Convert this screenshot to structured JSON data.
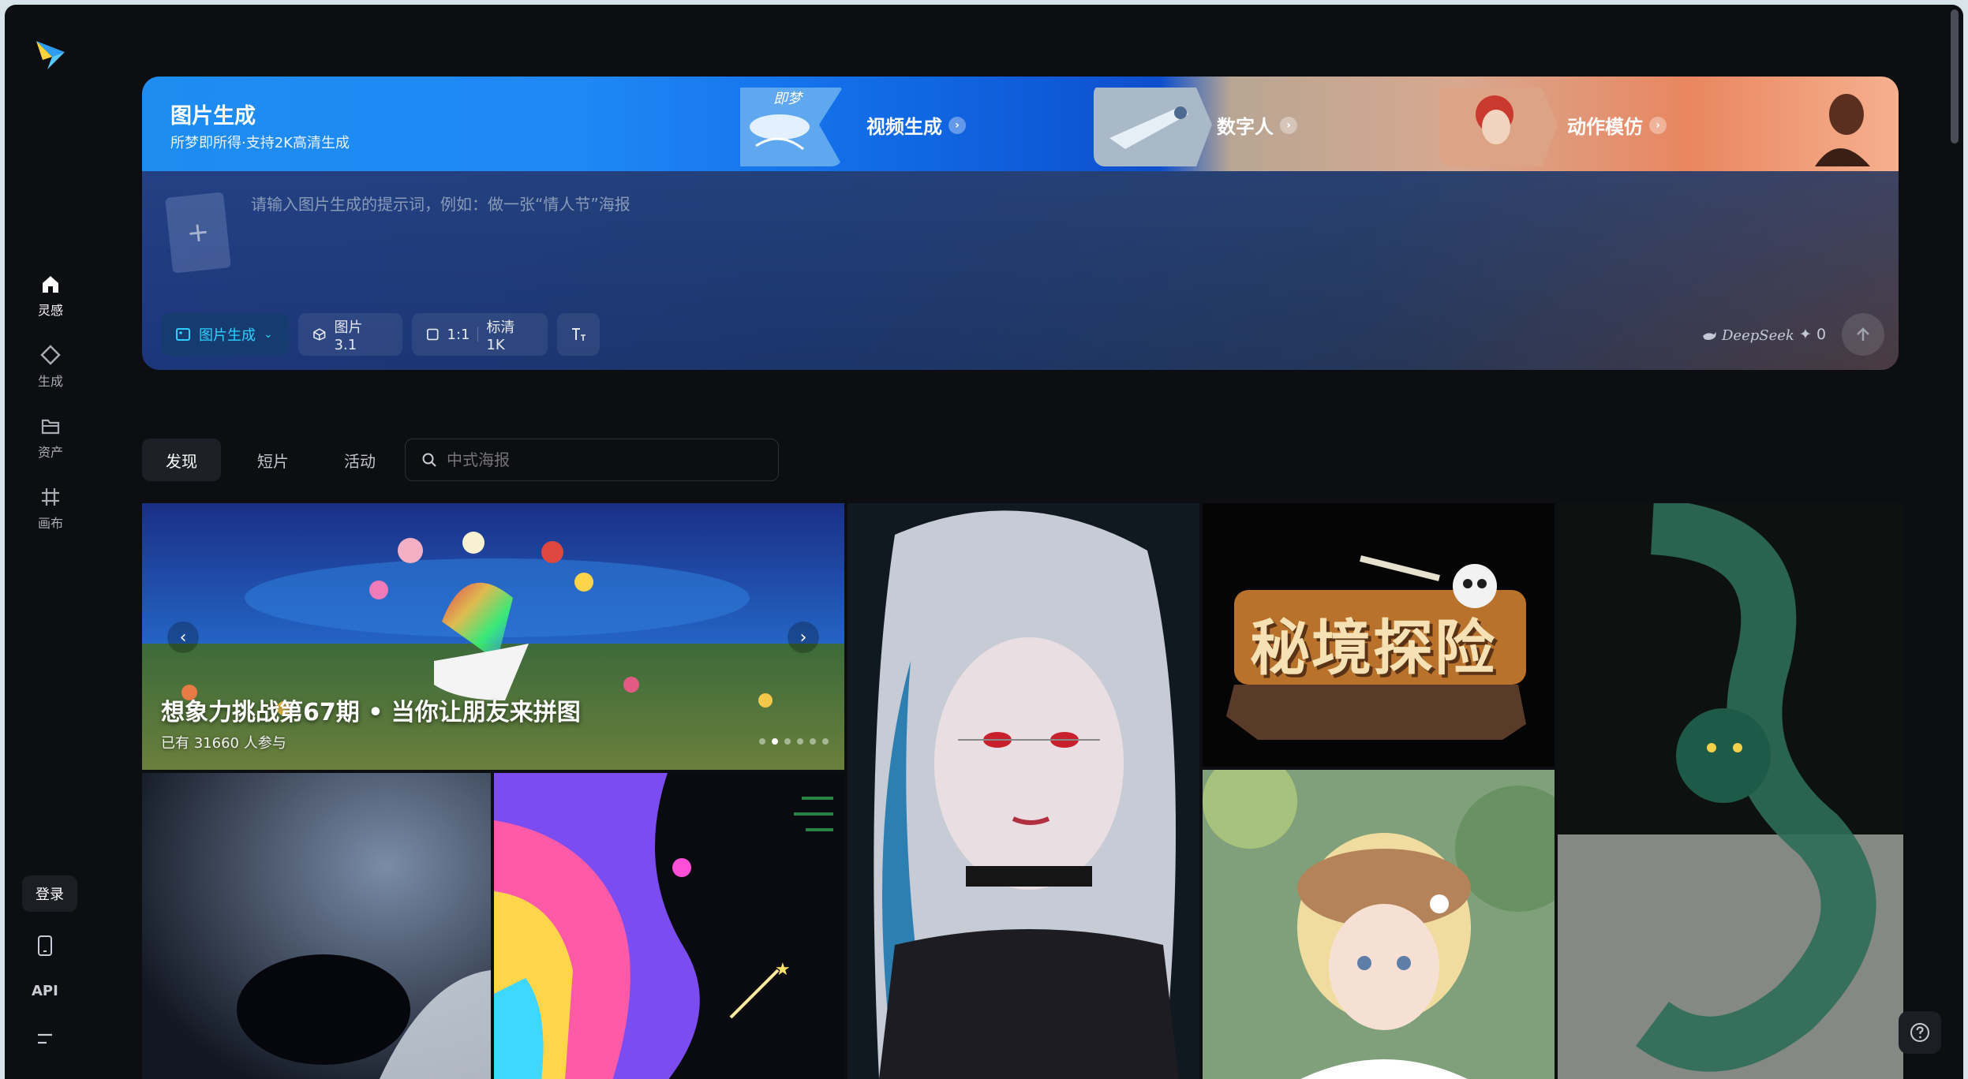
{
  "sidebar": {
    "items": [
      {
        "label": "灵感",
        "icon": "home-icon"
      },
      {
        "label": "生成",
        "icon": "diamond-icon"
      },
      {
        "label": "资产",
        "icon": "folder-icon"
      },
      {
        "label": "画布",
        "icon": "canvas-icon"
      }
    ],
    "login_label": "登录",
    "api_label": "API"
  },
  "hero": {
    "title": "图片生成",
    "subtitle": "所梦即所得·支持2K高清生成",
    "thumb_text": "即梦",
    "tabs": [
      {
        "label": "视频生成"
      },
      {
        "label": "数字人"
      },
      {
        "label": "动作模仿"
      }
    ],
    "prompt_placeholder": "请输入图片生成的提示词，例如：做一张“情人节”海报",
    "chips": {
      "mode": "图片生成",
      "model": "图片 3.1",
      "ratio": "1:1",
      "quality": "标清 1K"
    },
    "deepseek_label": "DeepSeek",
    "credits": "0"
  },
  "tabs": [
    {
      "label": "发现",
      "active": true
    },
    {
      "label": "短片",
      "active": false
    },
    {
      "label": "活动",
      "active": false
    }
  ],
  "search": {
    "placeholder": "中式海报"
  },
  "banner": {
    "title": "想象力挑战第67期 • 当你让朋友来拼图",
    "subtitle": "已有 31660 人参与"
  },
  "gallery": {
    "adventure_title": "秘境探险"
  },
  "colors": {
    "background": "#0d0e12",
    "accent": "#2fd0ff",
    "hero_blue": "#1d8df1",
    "hero_orange": "#e98660"
  }
}
